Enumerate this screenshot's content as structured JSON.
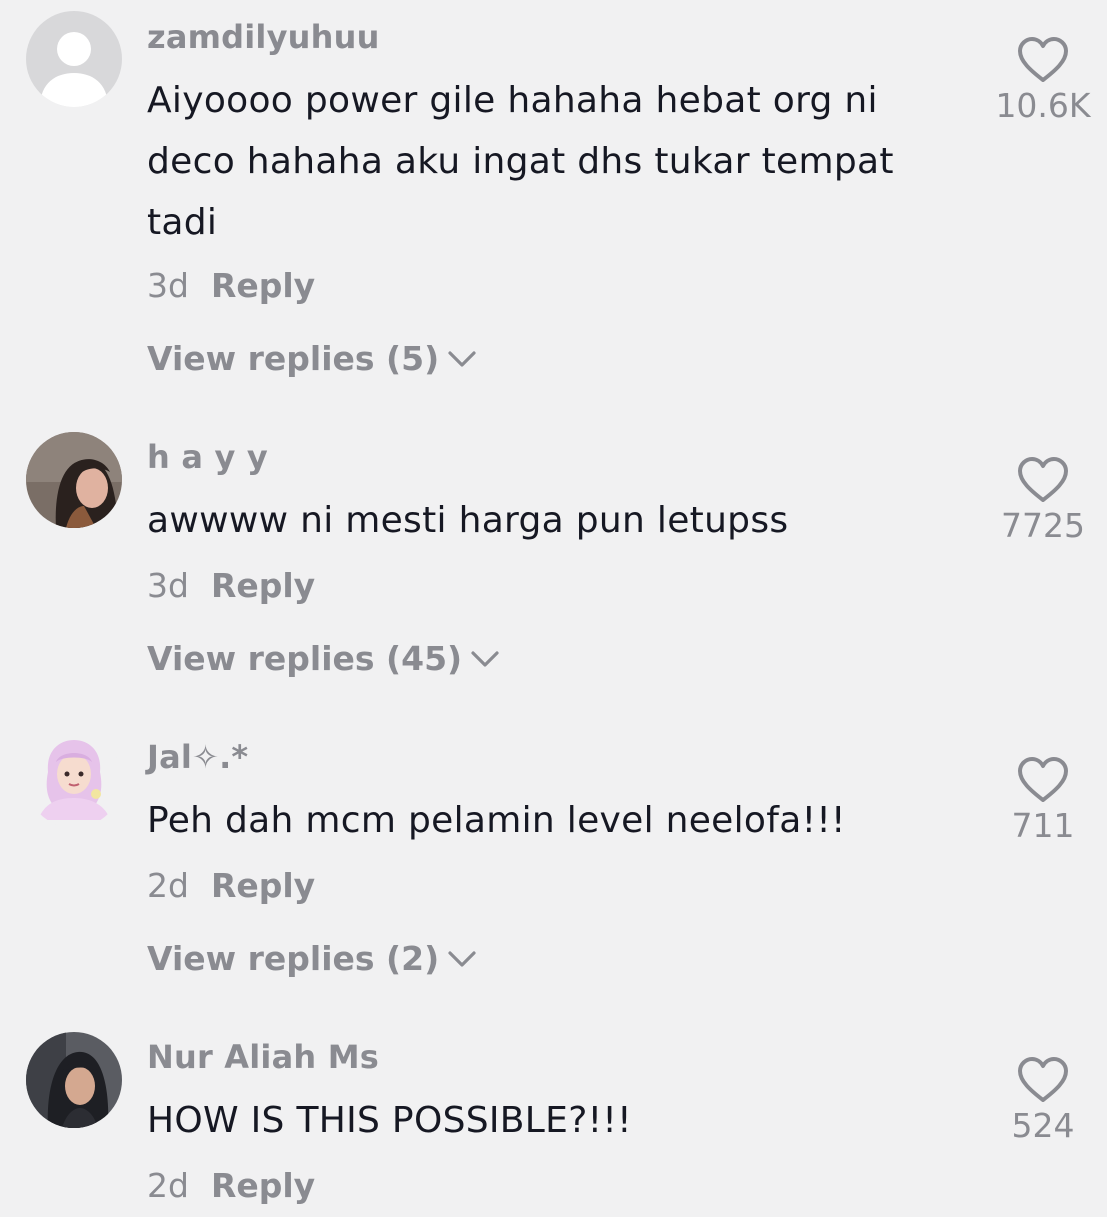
{
  "comments": [
    {
      "username": "zamdilyuhuu",
      "text": "Aiyoooo power gile hahaha hebat org ni deco hahaha aku ingat dhs tukar tempat tadi",
      "time": "3d",
      "reply_label": "Reply",
      "view_replies": "View replies (5)",
      "likes": "10.6K",
      "avatar": "default-avatar-icon"
    },
    {
      "username": "h a y y",
      "text": "awwww ni mesti harga pun letupss",
      "time": "3d",
      "reply_label": "Reply",
      "view_replies": "View replies (45)",
      "likes": "7725",
      "avatar": "user-photo"
    },
    {
      "username": "Jal✧.*",
      "text": "Peh dah mcm pelamin level neelofa!!!",
      "time": "2d",
      "reply_label": "Reply",
      "view_replies": "View replies (2)",
      "likes": "711",
      "avatar": "hijab-cartoon-avatar"
    },
    {
      "username": "Nur Aliah Ms",
      "text": "HOW IS THIS POSSIBLE?!!!",
      "time": "2d",
      "reply_label": "Reply",
      "likes": "524",
      "avatar": "user-photo"
    }
  ],
  "colors": {
    "background": "#f1f1f2",
    "primary_text": "#161823",
    "secondary_text": "#8a8b91"
  }
}
